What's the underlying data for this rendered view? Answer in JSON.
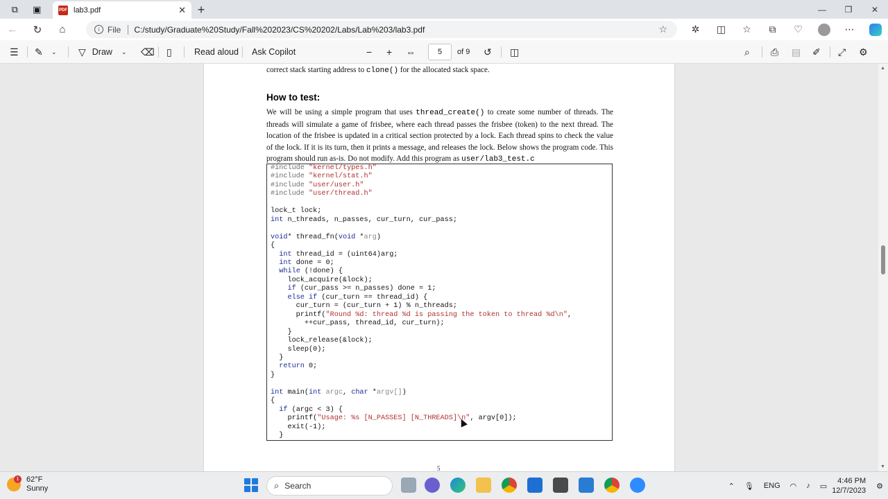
{
  "browser": {
    "tab_title": "lab3.pdf",
    "file_label": "File",
    "url": "C:/study/Graduate%20Study/Fall%202023/CS%20202/Labs/Lab%203/lab3.pdf"
  },
  "pdf_toolbar": {
    "draw_label": "Draw",
    "read_aloud_label": "Read aloud",
    "ask_copilot_label": "Ask Copilot",
    "current_page": "5",
    "page_total": "of 9"
  },
  "document": {
    "top_line_before": "correct stack starting address to",
    "top_line_code": "clone()",
    "top_line_after": "for the allocated stack space.",
    "heading": "How to test:",
    "para_1": "We will be using a simple program that uses",
    "para_code_1": "thread_create()",
    "para_2": "to create some number of threads. The threads will simulate a game of frisbee, where each thread passes the frisbee (token) to the next thread. The location of the frisbee is updated in a critical section protected by a lock. Each thread spins to check the value of the lock. If it is its turn, then it prints a message, and releases the lock. Below shows the program code. This program should run as-is. Do not modify. Add this program as",
    "para_code_2": "user/lab3_test.c",
    "page_number": "5"
  },
  "taskbar": {
    "temperature": "62°F",
    "condition": "Sunny",
    "weather_badge": "1",
    "search_label": "Search",
    "language": "ENG",
    "time": "4:46 PM",
    "date": "12/7/2023"
  },
  "colors": {
    "accent": "#1f7ae0",
    "pdf_icon": "#c42b1c",
    "code_keyword": "#1c2b95",
    "code_string": "#b03030"
  }
}
